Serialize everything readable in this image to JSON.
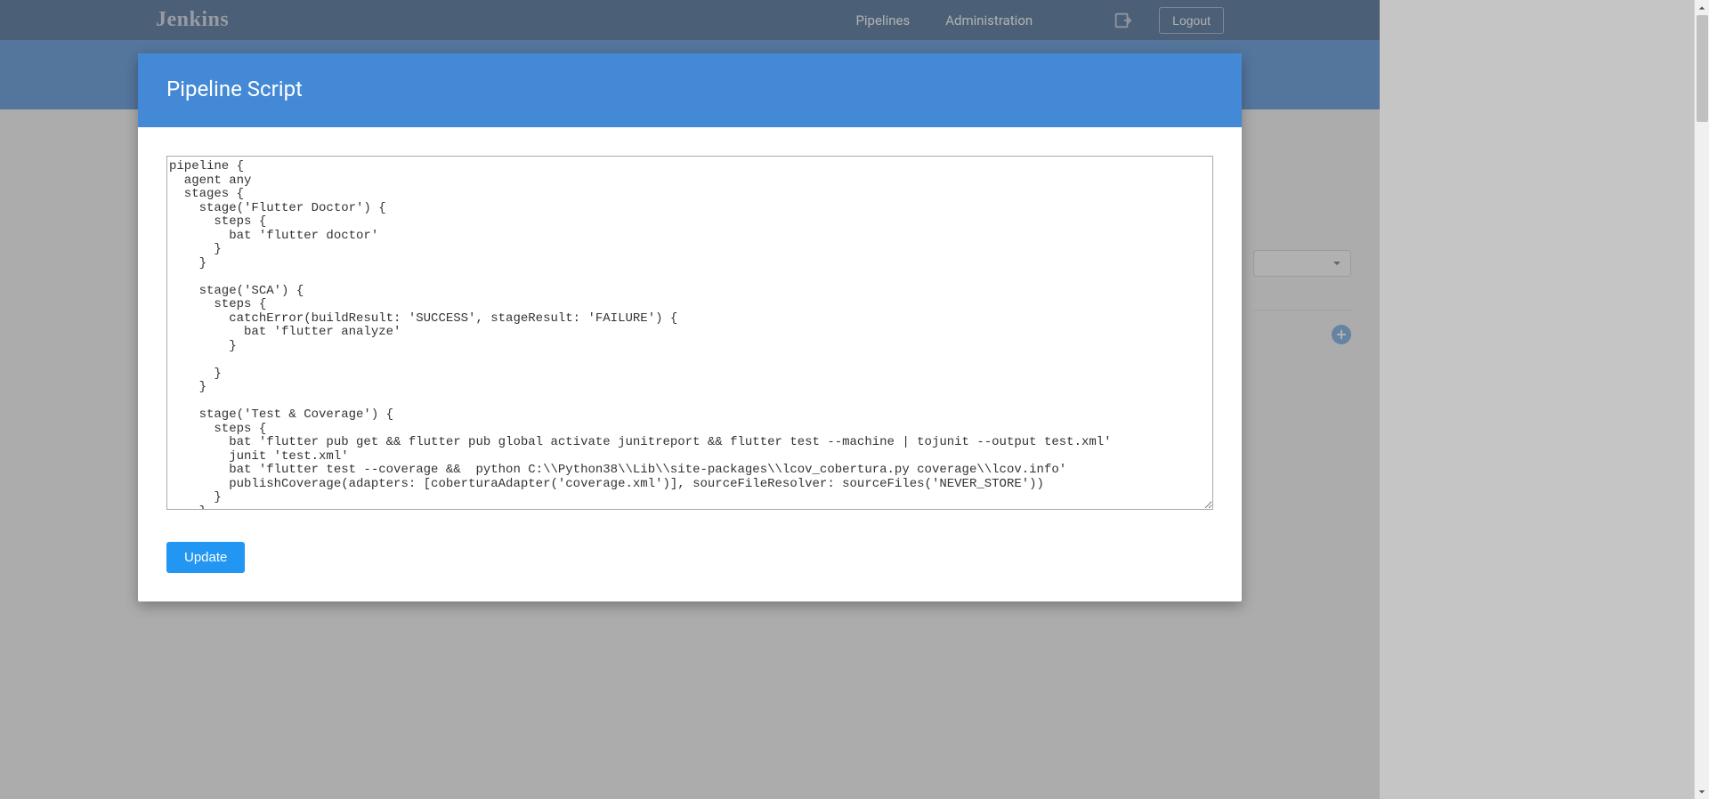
{
  "nav": {
    "logo": "Jenkins",
    "pipelines": "Pipelines",
    "administration": "Administration",
    "logout": "Logout"
  },
  "modal": {
    "title": "Pipeline Script",
    "update_button": "Update",
    "script": "pipeline {\n  agent any\n  stages {\n    stage('Flutter Doctor') {\n      steps {\n        bat 'flutter doctor'\n      }\n    }\n\n    stage('SCA') {\n      steps {\n        catchError(buildResult: 'SUCCESS', stageResult: 'FAILURE') {\n          bat 'flutter analyze'\n        }\n\n      }\n    }\n\n    stage('Test & Coverage') {\n      steps {\n        bat 'flutter pub get && flutter pub global activate junitreport && flutter test --machine | tojunit --output test.xml'\n        junit 'test.xml'\n        bat 'flutter test --coverage &&  python C:\\\\Python38\\\\Lib\\\\site-packages\\\\lcov_cobertura.py coverage\\\\lcov.info'\n        publishCoverage(adapters: [coberturaAdapter('coverage.xml')], sourceFileResolver: sourceFiles('NEVER_STORE'))\n      }\n    }"
  }
}
